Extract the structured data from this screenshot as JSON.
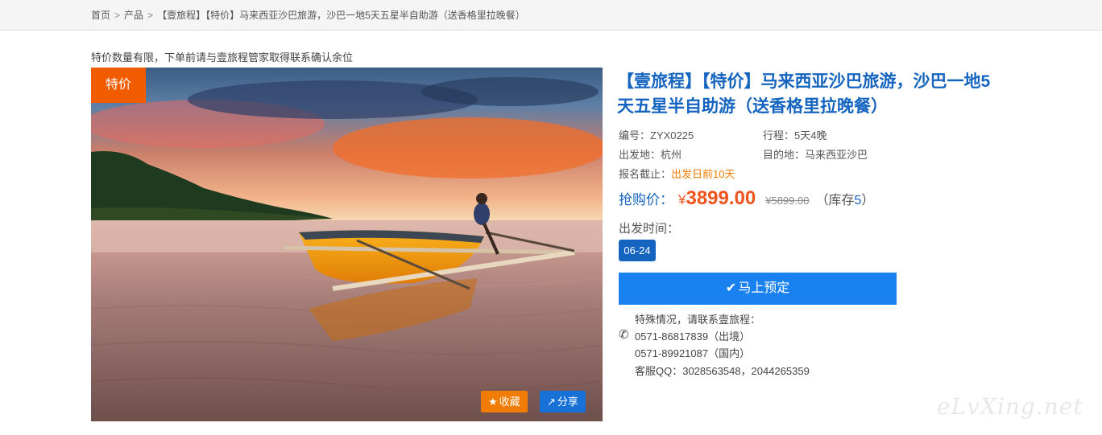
{
  "breadcrumb": {
    "home": "首页",
    "products": "产品",
    "current": "【壹旅程】【特价】马来西亚沙巴旅游，沙巴一地5天五星半自助游（送香格里拉晚餐）",
    "separator": ">"
  },
  "notice": "特价数量有限，下单前请与壹旅程管家取得联系确认余位",
  "photo": {
    "tag": "特价",
    "favorite_label": "收藏",
    "share_label": "分享"
  },
  "product": {
    "title": "【壹旅程】【特价】马来西亚沙巴旅游，沙巴一地5天五星半自助游（送香格里拉晚餐）",
    "code": {
      "label": "编号：",
      "value": "ZYX0225"
    },
    "duration": {
      "label": "行程：",
      "value": "5天4晚"
    },
    "origin": {
      "label": "出发地：",
      "value": "杭州"
    },
    "destination": {
      "label": "目的地：",
      "value": "马来西亚沙巴"
    },
    "deadline": {
      "label": "报名截止：",
      "value": "出发日前10天"
    }
  },
  "price": {
    "label": "抢购价：",
    "currency": "¥",
    "current": "3899.00",
    "original": "¥5899.00",
    "stock_prefix": "（库存",
    "stock": "5",
    "stock_suffix": "）"
  },
  "departure": {
    "label": "出发时间：",
    "dates": [
      "06-24"
    ]
  },
  "book_button": "马上预定",
  "contact": {
    "intro": "特殊情况，请联系壹旅程：",
    "phone_outbound": "0571-86817839（出境）",
    "phone_domestic": "0571-89921087（国内）",
    "qq": "客服QQ：3028563548，2044265359"
  },
  "watermark": "eLvXing.net",
  "colors": {
    "accent_blue": "#1565c0",
    "button_blue": "#1a82f0",
    "tag_orange": "#f25c00",
    "price_orange": "#f0541e"
  }
}
